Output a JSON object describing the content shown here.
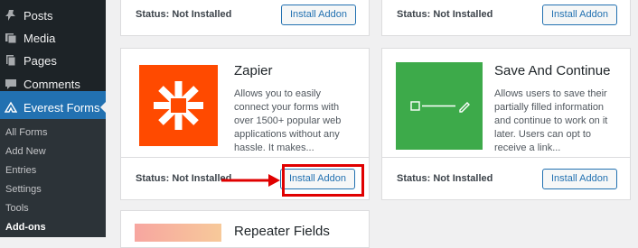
{
  "sidebar": {
    "menu": [
      {
        "label": "Posts",
        "icon": "pin-icon"
      },
      {
        "label": "Media",
        "icon": "media-icon"
      },
      {
        "label": "Pages",
        "icon": "pages-icon"
      },
      {
        "label": "Comments",
        "icon": "comments-icon"
      }
    ],
    "active": {
      "label": "Everest Forms",
      "icon": "everest-forms-icon"
    },
    "submenu": [
      "All Forms",
      "Add New",
      "Entries",
      "Settings",
      "Tools",
      "Add-ons"
    ],
    "current_submenu": "Add-ons"
  },
  "cards": {
    "top_left": {
      "status_label": "Status:",
      "status_value": "Not Installed",
      "button": "Install Addon"
    },
    "top_right": {
      "status_label": "Status:",
      "status_value": "Not Installed",
      "button": "Install Addon"
    },
    "zapier": {
      "title": "Zapier",
      "description": "Allows you to easily connect your forms with over 1500+ popular web applications without any hassle. It makes...",
      "status_label": "Status:",
      "status_value": "Not Installed",
      "button": "Install Addon",
      "thumb_color": "#ff4a00"
    },
    "save_continue": {
      "title": "Save And Continue",
      "description": "Allows users to save their partially filled information and continue to work on it later. Users can opt to receive a link...",
      "status_label": "Status:",
      "status_value": "Not Installed",
      "button": "Install Addon",
      "thumb_color": "#3daa4a"
    },
    "repeater": {
      "title": "Repeater Fields"
    }
  },
  "colors": {
    "accent": "#2271b1",
    "highlight": "#e00000",
    "sidebar_bg": "#1d2327"
  }
}
